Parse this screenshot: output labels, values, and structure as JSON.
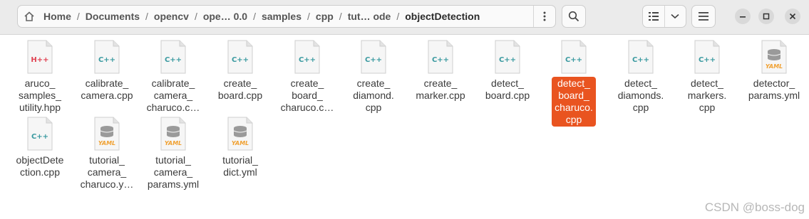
{
  "pathbar": {
    "crumbs": [
      "Home",
      "Documents",
      "opencv",
      "ope… 0.0",
      "samples",
      "cpp",
      "tut… ode",
      "objectDetection"
    ],
    "menu_icon": "vertical-dots-icon"
  },
  "toolbar": {
    "search_icon": "search-icon",
    "view_icon": "list-view-icon",
    "sort_icon": "chevron-down-icon",
    "menu_icon": "hamburger-icon"
  },
  "window": {
    "minimize_icon": "minimize-icon",
    "maximize_icon": "maximize-icon",
    "close_icon": "close-icon"
  },
  "colors": {
    "accent": "#e95420",
    "cpp_icon": "#3a9aa0",
    "hpp_icon": "#e04050",
    "yaml_icon": "#f0a030"
  },
  "files": [
    {
      "name": "aruco_\nsamples_\nutility.hpp",
      "type": "H++"
    },
    {
      "name": "calibrate_\ncamera.cpp",
      "type": "C++"
    },
    {
      "name": "calibrate_\ncamera_\ncharuco.c…",
      "type": "C++"
    },
    {
      "name": "create_\nboard.cpp",
      "type": "C++"
    },
    {
      "name": "create_\nboard_\ncharuco.c…",
      "type": "C++"
    },
    {
      "name": "create_\ndiamond.\ncpp",
      "type": "C++"
    },
    {
      "name": "create_\nmarker.cpp",
      "type": "C++"
    },
    {
      "name": "detect_\nboard.cpp",
      "type": "C++"
    },
    {
      "name": "detect_\nboard_\ncharuco.\ncpp",
      "type": "C++",
      "selected": true
    },
    {
      "name": "detect_\ndiamonds.\ncpp",
      "type": "C++"
    },
    {
      "name": "detect_\nmarkers.\ncpp",
      "type": "C++"
    },
    {
      "name": "detector_\nparams.yml",
      "type": "YAML"
    },
    {
      "name": "objectDete\nction.cpp",
      "type": "C++"
    },
    {
      "name": "tutorial_\ncamera_\ncharuco.y…",
      "type": "YAML"
    },
    {
      "name": "tutorial_\ncamera_\nparams.yml",
      "type": "YAML"
    },
    {
      "name": "tutorial_\ndict.yml",
      "type": "YAML"
    }
  ],
  "watermark": "CSDN @boss-dog"
}
